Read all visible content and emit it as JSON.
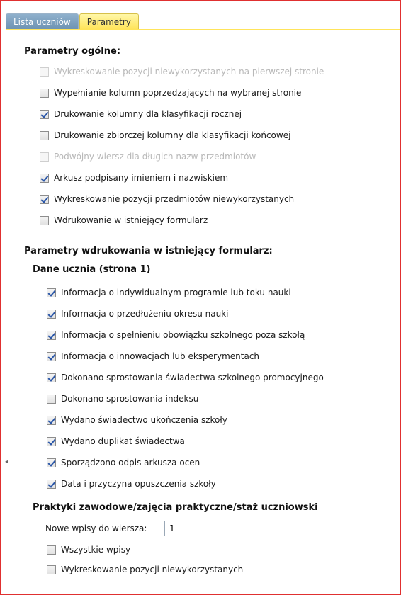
{
  "tabs": [
    {
      "label": "Lista uczniów",
      "active": false
    },
    {
      "label": "Parametry",
      "active": true
    }
  ],
  "general": {
    "title": "Parametry ogólne:",
    "items": [
      {
        "label": "Wykreskowanie pozycji niewykorzystanych na pierwszej stronie",
        "checked": false,
        "disabled": true
      },
      {
        "label": "Wypełnianie kolumn poprzedzających na wybranej stronie",
        "checked": false,
        "disabled": false
      },
      {
        "label": "Drukowanie kolumny dla klasyfikacji rocznej",
        "checked": true,
        "disabled": false
      },
      {
        "label": "Drukowanie zbiorczej kolumny dla klasyfikacji końcowej",
        "checked": false,
        "disabled": false
      },
      {
        "label": "Podwójny wiersz dla długich nazw przedmiotów",
        "checked": false,
        "disabled": true
      },
      {
        "label": "Arkusz podpisany imieniem i nazwiskiem",
        "checked": true,
        "disabled": false
      },
      {
        "label": "Wykreskowanie pozycji przedmiotów niewykorzystanych",
        "checked": true,
        "disabled": false
      },
      {
        "label": "Wdrukowanie w istniejący formularz",
        "checked": false,
        "disabled": false
      }
    ]
  },
  "print_form": {
    "title": "Parametry wdrukowania w istniejący formularz:",
    "student": {
      "title": "Dane ucznia (strona 1)",
      "items": [
        {
          "label": "Informacja o indywidualnym programie lub toku nauki",
          "checked": true
        },
        {
          "label": "Informacja o przedłużeniu okresu nauki",
          "checked": true
        },
        {
          "label": "Informacja o spełnieniu obowiązku szkolnego poza szkołą",
          "checked": true
        },
        {
          "label": "Informacja o innowacjach lub eksperymentach",
          "checked": true
        },
        {
          "label": "Dokonano sprostowania świadectwa szkolnego promocyjnego",
          "checked": true
        },
        {
          "label": "Dokonano sprostowania indeksu",
          "checked": false
        },
        {
          "label": "Wydano świadectwo ukończenia szkoły",
          "checked": true
        },
        {
          "label": "Wydano duplikat świadectwa",
          "checked": true
        },
        {
          "label": "Sporządzono odpis arkusza ocen",
          "checked": true
        },
        {
          "label": "Data i przyczyna opuszczenia szkoły",
          "checked": true
        }
      ]
    },
    "practice": {
      "title": "Praktyki zawodowe/zajęcia praktyczne/staż uczniowski",
      "new_entries_label": "Nowe wpisy do wiersza:",
      "new_entries_value": "1",
      "items": [
        {
          "label": "Wszystkie wpisy",
          "checked": false
        },
        {
          "label": "Wykreskowanie pozycji niewykorzystanych",
          "checked": false
        }
      ]
    }
  },
  "colors": {
    "frame_border": "#e03030",
    "active_tab": "#ffe45a",
    "inactive_tab": "#7c9fbe",
    "check": "#2a56a8"
  }
}
